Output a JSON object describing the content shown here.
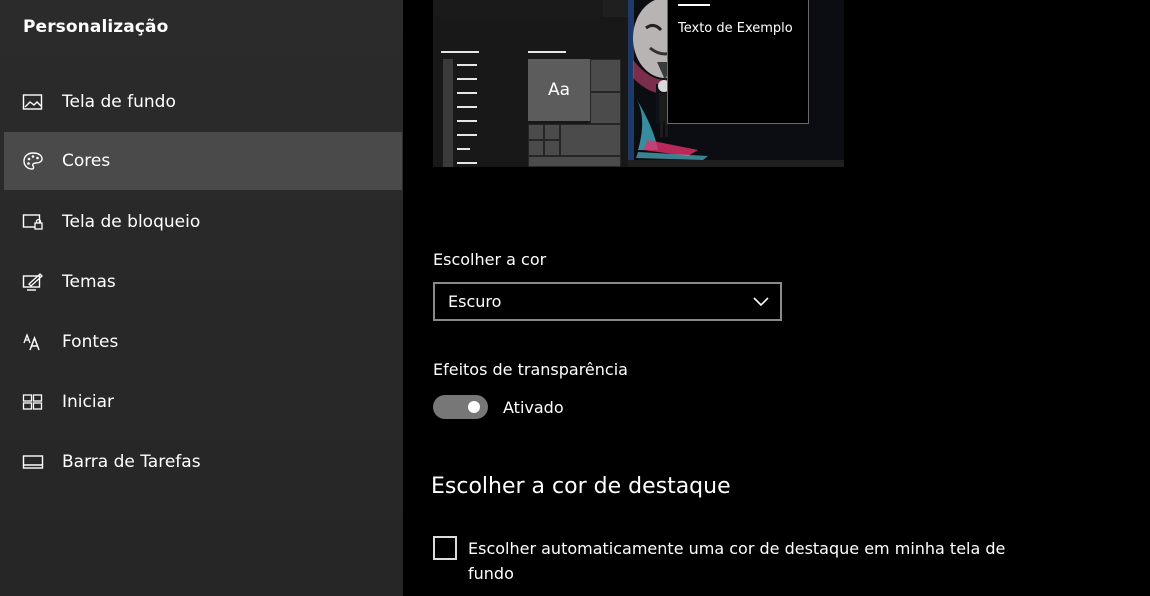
{
  "sidebar": {
    "title": "Personalização",
    "items": [
      {
        "label": "Tela de fundo",
        "icon": "picture-icon",
        "active": false
      },
      {
        "label": "Cores",
        "icon": "palette-icon",
        "active": true
      },
      {
        "label": "Tela de bloqueio",
        "icon": "lock-screen-icon",
        "active": false
      },
      {
        "label": "Temas",
        "icon": "themes-icon",
        "active": false
      },
      {
        "label": "Fontes",
        "icon": "fonts-icon",
        "active": false
      },
      {
        "label": "Iniciar",
        "icon": "start-icon",
        "active": false
      },
      {
        "label": "Barra de Tarefas",
        "icon": "taskbar-icon",
        "active": false
      }
    ]
  },
  "preview": {
    "tile_label": "Aa",
    "sample_text": "Texto de Exemplo"
  },
  "color_mode": {
    "label": "Escolher a cor",
    "selected": "Escuro"
  },
  "transparency": {
    "label": "Efeitos de transparência",
    "state_label": "Ativado",
    "on": true
  },
  "accent": {
    "heading": "Escolher a cor de destaque",
    "auto_checkbox_label": "Escolher automaticamente uma cor de destaque em minha tela de fundo",
    "auto_checked": false
  },
  "colors": {
    "sidebar_bg": "#2b2b2b",
    "active_item_bg": "#4a4a4a",
    "main_bg": "#000000"
  }
}
